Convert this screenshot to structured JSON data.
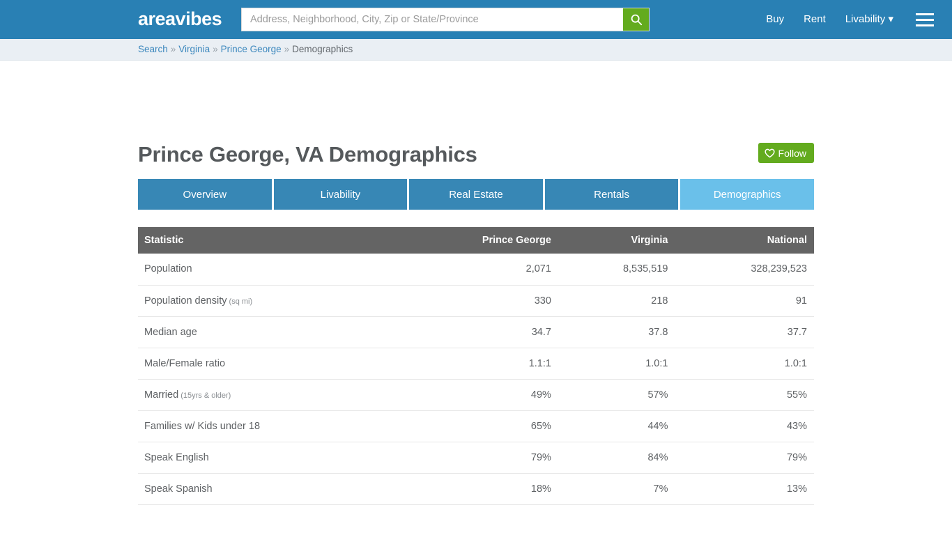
{
  "header": {
    "logo_text": "areavibes",
    "logo_icon": "soundwave-icon",
    "search": {
      "placeholder": "Address, Neighborhood, City, Zip or State/Province",
      "value": "",
      "button_icon": "search-icon"
    },
    "nav": [
      {
        "label": "Buy",
        "name": "nav-buy"
      },
      {
        "label": "Rent",
        "name": "nav-rent"
      },
      {
        "label": "Livability ▾",
        "name": "nav-livability"
      }
    ],
    "menu_icon": "hamburger-icon",
    "colors": {
      "bar": "#2980b4",
      "accent_green": "#63ab1e"
    }
  },
  "breadcrumb": {
    "items": [
      {
        "label": "Search",
        "link": true
      },
      {
        "label": "Virginia",
        "link": true
      },
      {
        "label": "Prince George",
        "link": true
      },
      {
        "label": "Demographics",
        "link": false
      }
    ],
    "separator": "»"
  },
  "page": {
    "title": "Prince George, VA Demographics",
    "follow_label": "Follow",
    "follow_icon": "heart-icon"
  },
  "tabs": [
    {
      "label": "Overview",
      "name": "tab-overview",
      "active": false
    },
    {
      "label": "Livability",
      "name": "tab-livability",
      "active": false
    },
    {
      "label": "Real Estate",
      "name": "tab-real-estate",
      "active": false
    },
    {
      "label": "Rentals",
      "name": "tab-rentals",
      "active": false
    },
    {
      "label": "Demographics",
      "name": "tab-demographics",
      "active": true
    }
  ],
  "table": {
    "columns": [
      "Statistic",
      "Prince George",
      "Virginia",
      "National"
    ],
    "rows": [
      {
        "stat": "Population",
        "suffix": "",
        "local": "2,071",
        "state": "8,535,519",
        "national": "328,239,523"
      },
      {
        "stat": "Population density",
        "suffix": "(sq mi)",
        "local": "330",
        "state": "218",
        "national": "91"
      },
      {
        "stat": "Median age",
        "suffix": "",
        "local": "34.7",
        "state": "37.8",
        "national": "37.7"
      },
      {
        "stat": "Male/Female ratio",
        "suffix": "",
        "local": "1.1:1",
        "state": "1.0:1",
        "national": "1.0:1"
      },
      {
        "stat": "Married",
        "suffix": "(15yrs & older)",
        "local": "49%",
        "state": "57%",
        "national": "55%"
      },
      {
        "stat": "Families w/ Kids under 18",
        "suffix": "",
        "local": "65%",
        "state": "44%",
        "national": "43%"
      },
      {
        "stat": "Speak English",
        "suffix": "",
        "local": "79%",
        "state": "84%",
        "national": "79%"
      },
      {
        "stat": "Speak Spanish",
        "suffix": "",
        "local": "18%",
        "state": "7%",
        "national": "13%"
      }
    ]
  }
}
